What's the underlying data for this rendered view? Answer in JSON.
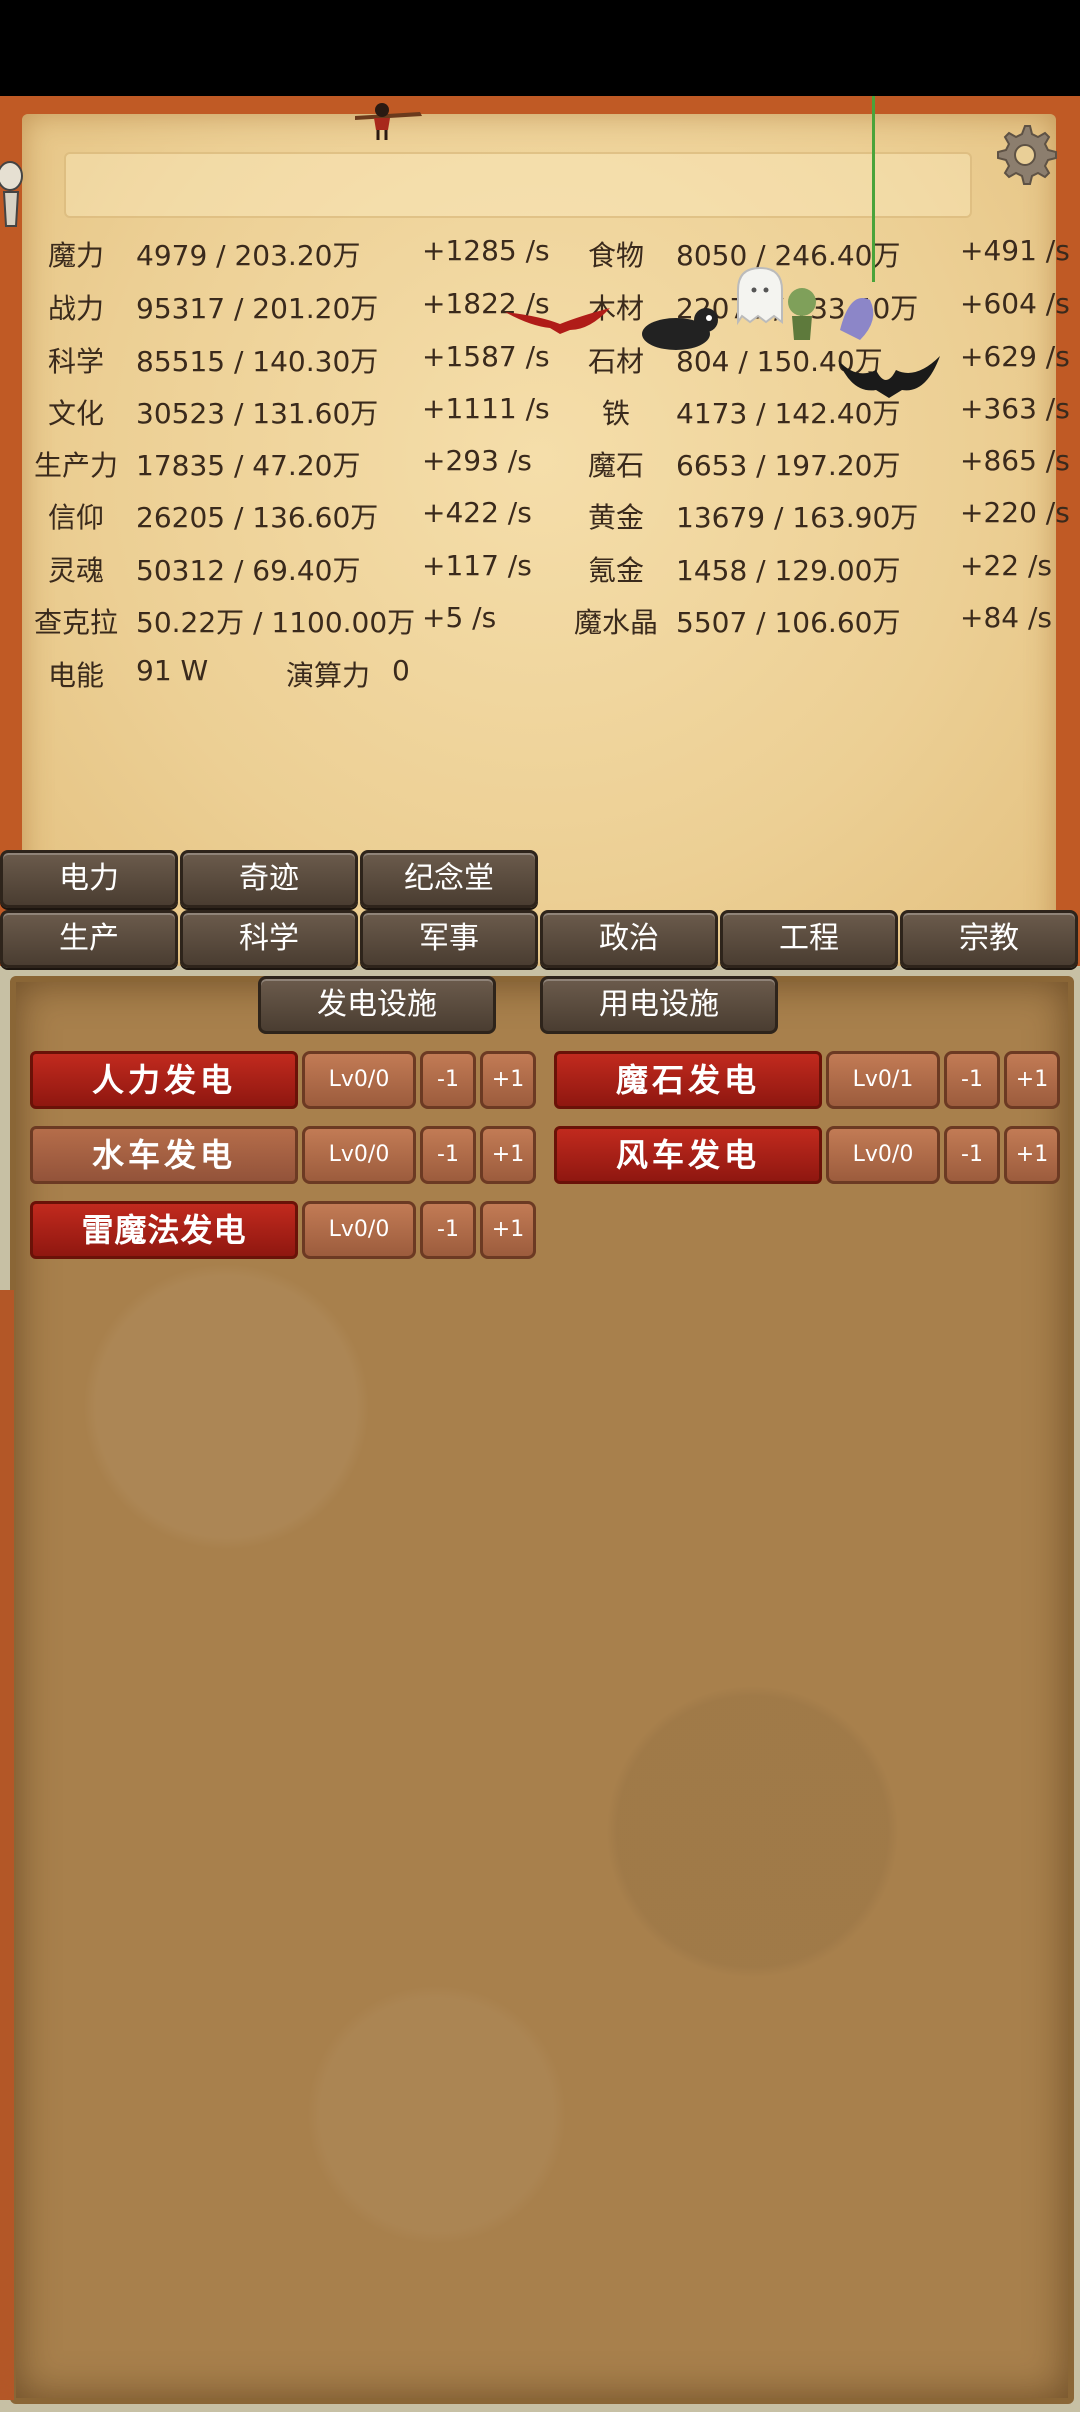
{
  "resources": [
    {
      "name1": "魔力",
      "val1": "4979 / 203.20万",
      "rate1": "+1285 /s",
      "name2": "食物",
      "val2": "8050 / 246.40万",
      "rate2": "+491 /s"
    },
    {
      "name1": "战力",
      "val1": "95317 / 201.20万",
      "rate1": "+1822 /s",
      "name2": "木材",
      "val2": "22078 / 133.40万",
      "rate2": "+604 /s"
    },
    {
      "name1": "科学",
      "val1": "85515 / 140.30万",
      "rate1": "+1587 /s",
      "name2": "石材",
      "val2": "804 / 150.40万",
      "rate2": "+629 /s"
    },
    {
      "name1": "文化",
      "val1": "30523 / 131.60万",
      "rate1": "+1111 /s",
      "name2": "铁",
      "val2": "4173 / 142.40万",
      "rate2": "+363 /s"
    },
    {
      "name1": "生产力",
      "val1": "17835 / 47.20万",
      "rate1": "+293 /s",
      "name2": "魔石",
      "val2": "6653 / 197.20万",
      "rate2": "+865 /s"
    },
    {
      "name1": "信仰",
      "val1": "26205 / 136.60万",
      "rate1": "+422 /s",
      "name2": "黄金",
      "val2": "13679 / 163.90万",
      "rate2": "+220 /s"
    },
    {
      "name1": "灵魂",
      "val1": "50312 / 69.40万",
      "rate1": "+117 /s",
      "name2": "氪金",
      "val2": "1458 / 129.00万",
      "rate2": "+22 /s"
    },
    {
      "name1": "查克拉",
      "val1": "50.22万 / 1100.00万",
      "rate1": "+5 /s",
      "name2": "魔水晶",
      "val2": "5507 / 106.60万",
      "rate2": "+84 /s"
    }
  ],
  "power": {
    "label": "电能",
    "value": "91 W",
    "compute_label": "演算力",
    "compute_value": "0"
  },
  "tabs_row1": [
    "电力",
    "奇迹",
    "纪念堂"
  ],
  "tabs_row2": [
    "生产",
    "科学",
    "军事",
    "政治",
    "工程",
    "宗教"
  ],
  "subtabs": [
    "发电设施",
    "用电设施"
  ],
  "generators": [
    {
      "name": "人力发电",
      "level": "Lv0/0",
      "minus": "-1",
      "plus": "+1"
    },
    {
      "name": "魔石发电",
      "level": "Lv0/1",
      "minus": "-1",
      "plus": "+1"
    },
    {
      "name": "水车发电",
      "level": "Lv0/0",
      "minus": "-1",
      "plus": "+1"
    },
    {
      "name": "风车发电",
      "level": "Lv0/0",
      "minus": "-1",
      "plus": "+1"
    },
    {
      "name": "雷魔法发电",
      "level": "Lv0/0",
      "minus": "-1",
      "plus": "+1"
    }
  ]
}
